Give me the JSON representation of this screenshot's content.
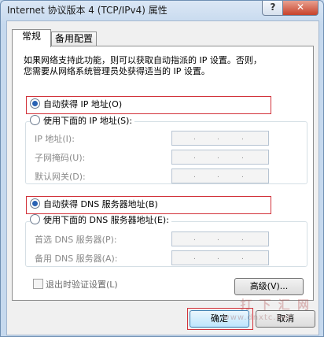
{
  "window": {
    "title": "Internet 协议版本 4 (TCP/IPv4) 属性",
    "help_glyph": "?",
    "close_glyph": "✕"
  },
  "tabs": [
    {
      "label": "常规",
      "active": true
    },
    {
      "label": "备用配置",
      "active": false
    }
  ],
  "description": "如果网络支持此功能，则可以获取自动指派的 IP 设置。否则，\n您需要从网络系统管理员处获得适当的 IP 设置。",
  "ip_section": {
    "auto_label": "自动获得 IP 地址(O)",
    "manual_label": "使用下面的 IP 地址(S):",
    "selected": "auto",
    "fields": [
      {
        "label": "IP 地址(I):"
      },
      {
        "label": "子网掩码(U):"
      },
      {
        "label": "默认网关(D):"
      }
    ]
  },
  "dns_section": {
    "auto_label": "自动获得 DNS 服务器地址(B)",
    "manual_label": "使用下面的 DNS 服务器地址(E):",
    "selected": "auto",
    "fields": [
      {
        "label": "首选 DNS 服务器(P):"
      },
      {
        "label": "备用 DNS 服务器(A):"
      }
    ]
  },
  "validate_checkbox": {
    "label": "退出时验证设置(L)",
    "checked": false
  },
  "buttons": {
    "advanced": "高级(V)...",
    "ok": "确定",
    "cancel": "取消"
  },
  "watermark": {
    "text": "打 下 汇 网",
    "url": "www.dnxtc.net"
  },
  "colors": {
    "highlight_border": "#d2323a",
    "radio_selected": "#2a62b3"
  }
}
